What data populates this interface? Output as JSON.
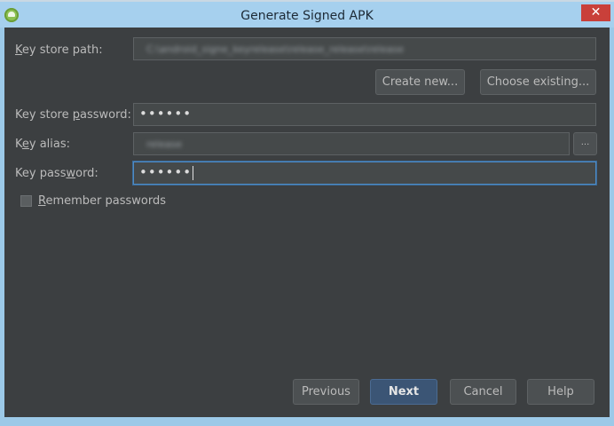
{
  "window": {
    "title": "Generate Signed APK",
    "close_label": "✕"
  },
  "background_hint": "",
  "labels": {
    "key_store_path_prefix": "K",
    "key_store_path_rest": "ey store path:",
    "key_store_password_pre": "Key store ",
    "key_store_password_u": "p",
    "key_store_password_post": "assword:",
    "key_alias_pre": "K",
    "key_alias_u": "e",
    "key_alias_post": "y alias:",
    "key_password_pre": "Key pass",
    "key_password_u": "w",
    "key_password_post": "ord:",
    "remember_u": "R",
    "remember_rest": "emember passwords"
  },
  "fields": {
    "key_store_path": "C:\\android_signe_keyrelease\\release_release\\release",
    "key_store_password": "••••••",
    "key_alias": "release",
    "key_password": "••••••"
  },
  "buttons": {
    "create_new": "Create new...",
    "choose_existing": "Choose existing...",
    "alias_browse": "...",
    "previous": "Previous",
    "next": "Next",
    "cancel": "Cancel",
    "help": "Help"
  },
  "checkbox": {
    "remember_passwords_checked": false
  },
  "colors": {
    "title_bar": "#a6d0ee",
    "panel": "#3c3f41",
    "close": "#c9403a",
    "default_button": "#3b5575",
    "focus_border": "#4d8bc7"
  }
}
